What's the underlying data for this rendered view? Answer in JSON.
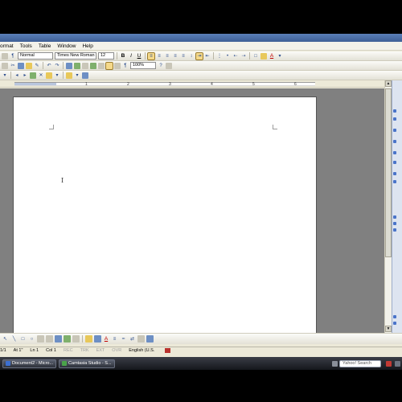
{
  "menubar": {
    "items": [
      "ormat",
      "Tools",
      "Table",
      "Window",
      "Help"
    ]
  },
  "formatting": {
    "style": "Normal",
    "font": "Times New Roman",
    "size": "12",
    "bold": "B",
    "italic": "I",
    "underline": "U",
    "font_color_letter": "A"
  },
  "standard": {
    "zoom": "100%"
  },
  "ruler": {
    "numbers": [
      "1",
      "2",
      "3",
      "4",
      "5",
      "6"
    ]
  },
  "status": {
    "page": "1/1",
    "at": "At 1\"",
    "line": "Ln 1",
    "col": "Col 1",
    "rec": "REC",
    "trk": "TRK",
    "ext": "EXT",
    "ovr": "OVR",
    "language": "English (U.S."
  },
  "drawing": {
    "font_color_letter": "A"
  },
  "taskbar": {
    "buttons": [
      "Document2 - Micro...",
      "Camtasia Studio - S..."
    ],
    "search_placeholder": "Yahoo! Search"
  },
  "colors": {
    "accent": "#6d8fc4",
    "doc_background": "#808080",
    "page": "#ffffff",
    "chrome": "#ece9d8"
  }
}
